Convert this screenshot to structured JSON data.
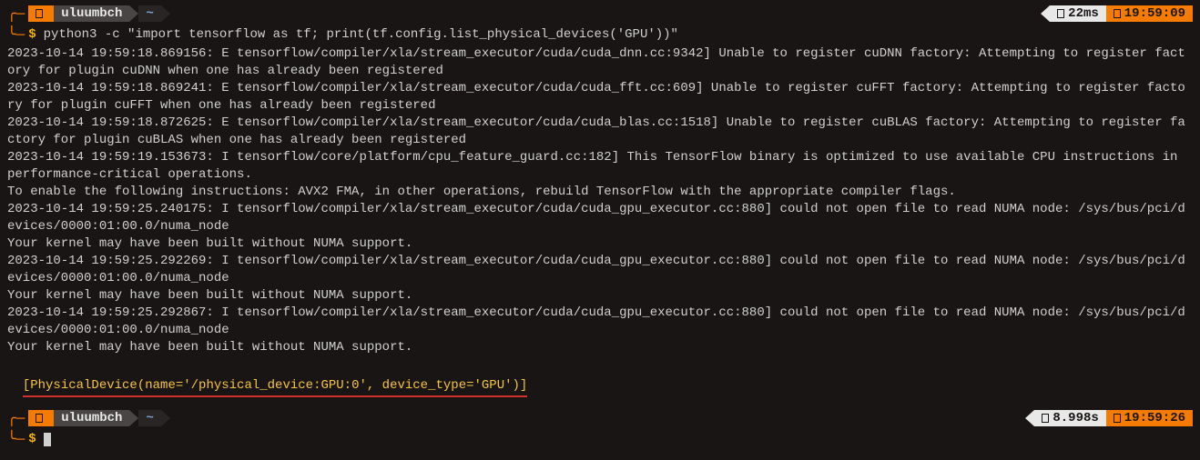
{
  "prompt1": {
    "user": "uluumbch",
    "path": "~",
    "exec_time": "22ms",
    "clock": "19:59:09"
  },
  "command1": "python3 -c \"import tensorflow as tf; print(tf.config.list_physical_devices('GPU'))\"",
  "output_lines": [
    "2023-10-14 19:59:18.869156: E tensorflow/compiler/xla/stream_executor/cuda/cuda_dnn.cc:9342] Unable to register cuDNN factory: Attempting to register factory for plugin cuDNN when one has already been registered",
    "2023-10-14 19:59:18.869241: E tensorflow/compiler/xla/stream_executor/cuda/cuda_fft.cc:609] Unable to register cuFFT factory: Attempting to register factory for plugin cuFFT when one has already been registered",
    "2023-10-14 19:59:18.872625: E tensorflow/compiler/xla/stream_executor/cuda/cuda_blas.cc:1518] Unable to register cuBLAS factory: Attempting to register factory for plugin cuBLAS when one has already been registered",
    "2023-10-14 19:59:19.153673: I tensorflow/core/platform/cpu_feature_guard.cc:182] This TensorFlow binary is optimized to use available CPU instructions in performance-critical operations.",
    "To enable the following instructions: AVX2 FMA, in other operations, rebuild TensorFlow with the appropriate compiler flags.",
    "2023-10-14 19:59:25.240175: I tensorflow/compiler/xla/stream_executor/cuda/cuda_gpu_executor.cc:880] could not open file to read NUMA node: /sys/bus/pci/devices/0000:01:00.0/numa_node",
    "Your kernel may have been built without NUMA support.",
    "2023-10-14 19:59:25.292269: I tensorflow/compiler/xla/stream_executor/cuda/cuda_gpu_executor.cc:880] could not open file to read NUMA node: /sys/bus/pci/devices/0000:01:00.0/numa_node",
    "Your kernel may have been built without NUMA support.",
    "2023-10-14 19:59:25.292867: I tensorflow/compiler/xla/stream_executor/cuda/cuda_gpu_executor.cc:880] could not open file to read NUMA node: /sys/bus/pci/devices/0000:01:00.0/numa_node",
    "Your kernel may have been built without NUMA support."
  ],
  "highlight_line": "[PhysicalDevice(name='/physical_device:GPU:0', device_type='GPU')]",
  "prompt2": {
    "user": "uluumbch",
    "path": "~",
    "exec_time": "8.998s",
    "clock": "19:59:26"
  },
  "dollar": "$"
}
